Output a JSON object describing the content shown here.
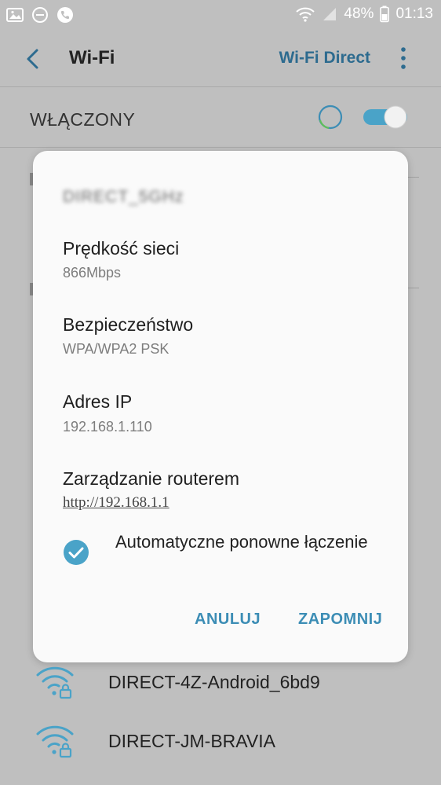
{
  "status_bar": {
    "battery": "48%",
    "time": "01:13"
  },
  "app_bar": {
    "title": "Wi-Fi",
    "wifi_direct": "Wi-Fi Direct"
  },
  "master_switch": {
    "label": "WŁĄCZONY",
    "state": "on"
  },
  "dialog": {
    "ssid": "DIRECT_5GHz",
    "fields": [
      {
        "label": "Prędkość sieci",
        "value": "866Mbps"
      },
      {
        "label": "Bezpieczeństwo",
        "value": "WPA/WPA2 PSK"
      },
      {
        "label": "Adres IP",
        "value": "192.168.1.110"
      },
      {
        "label": "Zarządzanie routerem",
        "value": "http://192.168.1.1"
      }
    ],
    "auto_reconnect": {
      "label": "Automatyczne ponowne łączenie",
      "checked": true
    },
    "cancel_label": "ANULUJ",
    "forget_label": "ZAPOMNIJ"
  },
  "networks": [
    {
      "name": "DIRECT-4Z-Android_6bd9",
      "secured": true
    },
    {
      "name": "DIRECT-JM-BRAVIA",
      "secured": true
    }
  ],
  "colors": {
    "accent": "#3c8db5",
    "toggle_on": "#4aa3c8",
    "scrim_background": "#bfbfbf",
    "dialog_background": "#fafafa"
  }
}
